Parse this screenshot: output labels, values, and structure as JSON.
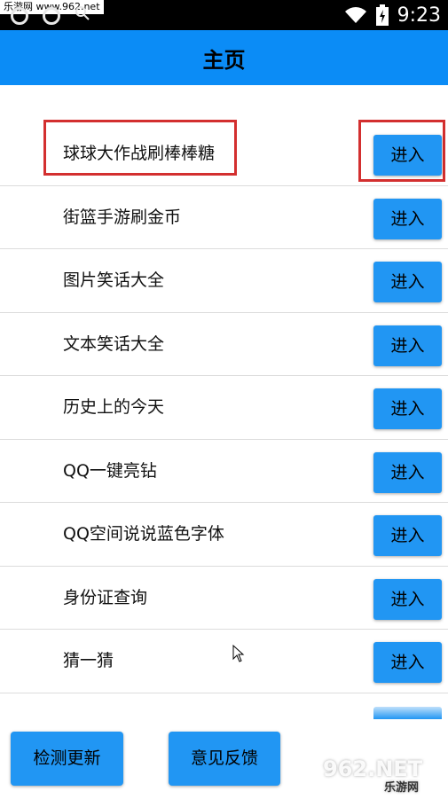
{
  "status_bar": {
    "watermark": "乐游网 www.962.net",
    "time": "9:23"
  },
  "app_bar": {
    "title": "主页"
  },
  "items": [
    {
      "label": "球球大作战刷棒棒糖",
      "button": "进入"
    },
    {
      "label": "街篮手游刷金币",
      "button": "进入"
    },
    {
      "label": "图片笑话大全",
      "button": "进入"
    },
    {
      "label": "文本笑话大全",
      "button": "进入"
    },
    {
      "label": "历史上的今天",
      "button": "进入"
    },
    {
      "label": "QQ一键亮钻",
      "button": "进入"
    },
    {
      "label": "QQ空间说说蓝色字体",
      "button": "进入"
    },
    {
      "label": "身份证查询",
      "button": "进入"
    },
    {
      "label": "猜一猜",
      "button": "进入"
    }
  ],
  "bottom": {
    "check_update": "检测更新",
    "feedback": "意见反馈"
  },
  "watermark_br": {
    "main": "962.NET",
    "sub": "乐游网"
  },
  "colors": {
    "accent": "#0b8cf6",
    "button": "#2196f3",
    "highlight": "#d32f2f"
  }
}
